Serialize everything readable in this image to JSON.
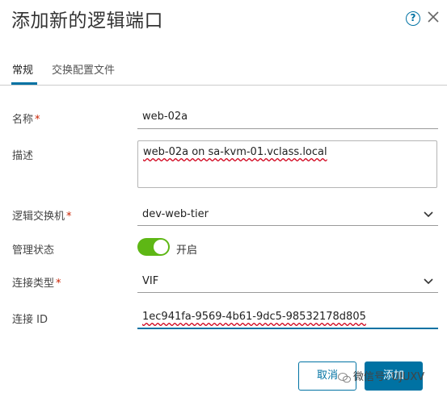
{
  "dialog": {
    "title": "添加新的逻辑端口",
    "help_icon": "help-icon",
    "close_icon": "close-icon"
  },
  "tabs": [
    {
      "label": "常规",
      "active": true
    },
    {
      "label": "交换配置文件",
      "active": false
    }
  ],
  "form": {
    "name": {
      "label": "名称",
      "required_mark": "*",
      "value": "web-02a"
    },
    "description": {
      "label": "描述",
      "value": "web-02a on sa-kvm-01.vclass.local"
    },
    "logical_switch": {
      "label": "逻辑交换机",
      "required_mark": "*",
      "value": "dev-web-tier"
    },
    "admin_state": {
      "label": "管理状态",
      "toggle_on": true,
      "toggle_label": "开启"
    },
    "attachment_type": {
      "label": "连接类型",
      "required_mark": "*",
      "value": "VIF"
    },
    "attachment_id": {
      "label": "连接 ID",
      "value": "1ec941fa-9569-4b61-9dc5-98532178d805"
    }
  },
  "footer": {
    "cancel_label": "取消",
    "add_label": "添加"
  },
  "watermark": {
    "text": "微信号: UJUXV"
  },
  "colors": {
    "accent": "#0072a3",
    "toggle_on": "#5eb715",
    "required": "#c92100"
  }
}
